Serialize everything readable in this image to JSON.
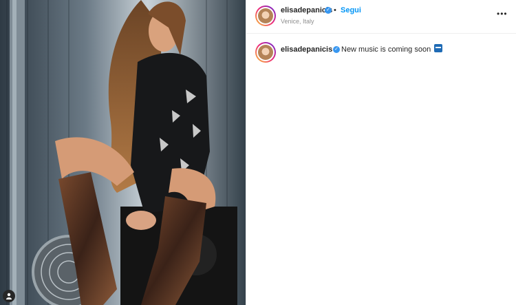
{
  "post": {
    "username": "elisadepanicis",
    "separator": "•",
    "follow_label": "Segui",
    "location": "Venice, Italy",
    "more_label": "•••"
  },
  "caption": {
    "username": "elisadepanicis",
    "text": "New music is coming soon"
  },
  "colors": {
    "follow": "#0095f6",
    "verified": "#3897f0",
    "location": "#8e8e8e"
  }
}
